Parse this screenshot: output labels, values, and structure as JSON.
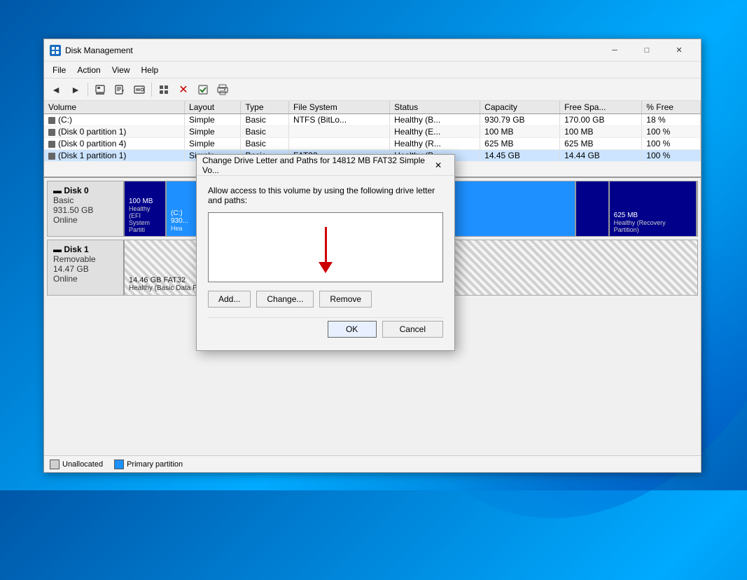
{
  "background": {
    "color": "#0060b0"
  },
  "window": {
    "title": "Disk Management",
    "titlebar_icon": "⊞",
    "buttons": {
      "minimize": "─",
      "maximize": "□",
      "close": "✕"
    }
  },
  "menubar": {
    "items": [
      {
        "label": "File"
      },
      {
        "label": "Action"
      },
      {
        "label": "View"
      },
      {
        "label": "Help"
      }
    ]
  },
  "toolbar": {
    "buttons": [
      {
        "name": "back",
        "icon": "◄",
        "label": "Back"
      },
      {
        "name": "forward",
        "icon": "►",
        "label": "Forward"
      },
      {
        "name": "disk-icon",
        "icon": "▦"
      },
      {
        "name": "edit-icon",
        "icon": "✎"
      },
      {
        "name": "disk2-icon",
        "icon": "⊟"
      },
      {
        "name": "wizard-icon",
        "icon": "⊞"
      },
      {
        "name": "delete-icon",
        "icon": "✕",
        "color": "red"
      },
      {
        "name": "check-icon",
        "icon": "✔"
      },
      {
        "name": "print-icon",
        "icon": "⊡"
      }
    ]
  },
  "volume_table": {
    "headers": [
      "Volume",
      "Layout",
      "Type",
      "File System",
      "Status",
      "Capacity",
      "Free Spa...",
      "% Free"
    ],
    "rows": [
      {
        "volume": "(C:)",
        "layout": "Simple",
        "type": "Basic",
        "filesystem": "NTFS (BitLo...",
        "status": "Healthy (B...",
        "capacity": "930.79 GB",
        "free_space": "170.00 GB",
        "pct_free": "18 %",
        "selected": false
      },
      {
        "volume": "(Disk 0 partition 1)",
        "layout": "Simple",
        "type": "Basic",
        "filesystem": "",
        "status": "Healthy (E...",
        "capacity": "100 MB",
        "free_space": "100 MB",
        "pct_free": "100 %",
        "selected": false
      },
      {
        "volume": "(Disk 0 partition 4)",
        "layout": "Simple",
        "type": "Basic",
        "filesystem": "",
        "status": "Healthy (R...",
        "capacity": "625 MB",
        "free_space": "625 MB",
        "pct_free": "100 %",
        "selected": false
      },
      {
        "volume": "(Disk 1 partition 1)",
        "layout": "Simple",
        "type": "Basic",
        "filesystem": "FAT32",
        "status": "Healthy (B...",
        "capacity": "14.45 GB",
        "free_space": "14.44 GB",
        "pct_free": "100 %",
        "selected": true
      }
    ]
  },
  "disk_map": {
    "disks": [
      {
        "name": "Disk 0",
        "type": "Basic",
        "size": "931.50 GB",
        "status": "Online",
        "partitions": [
          {
            "label": "100 MB\nHealthy (EFI System Partiti",
            "width": "3%",
            "style": "blue-dark"
          },
          {
            "label": "(C:)\n930...\nHea",
            "width": "80%",
            "style": "blue-medium"
          },
          {
            "label": "",
            "width": "5%",
            "style": "blue-dark"
          },
          {
            "label": "625 MB\nHealthy (Recovery Partition)",
            "width": "12%",
            "style": "blue-dark"
          }
        ]
      },
      {
        "name": "Disk 1",
        "type": "Removable",
        "size": "14.47 GB",
        "status": "Online",
        "partitions": [
          {
            "label": "14.46 GB FAT32\nHealthy (Basic Data Partition)",
            "width": "100%",
            "style": "striped"
          }
        ]
      }
    ]
  },
  "status_bar": {
    "legend": [
      {
        "label": "Unallocated",
        "color": "#d0d0d0"
      },
      {
        "label": "Primary partition",
        "color": "#1e90ff"
      }
    ]
  },
  "modal": {
    "title": "Change Drive Letter and Paths for 14812 MB FAT32 Simple Vo...",
    "close_btn": "✕",
    "description": "Allow access to this volume by using the following drive letter and paths:",
    "listbox_empty": true,
    "buttons": {
      "add": "Add...",
      "change": "Change...",
      "remove": "Remove"
    },
    "footer": {
      "ok": "OK",
      "cancel": "Cancel"
    }
  }
}
